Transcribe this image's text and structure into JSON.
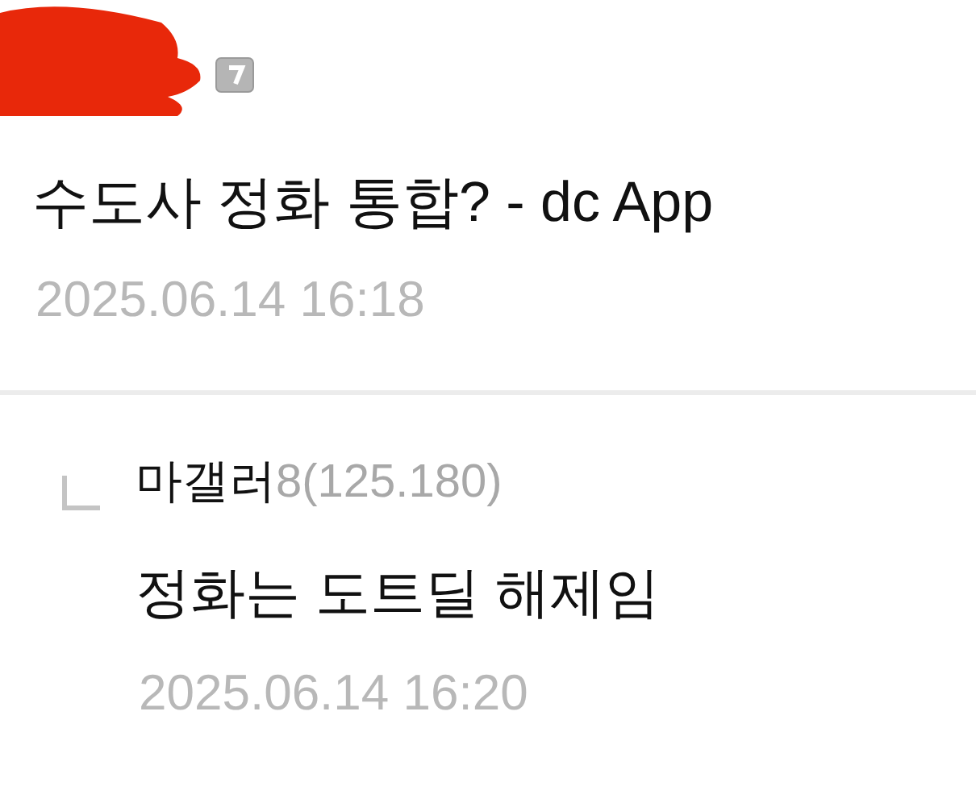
{
  "post": {
    "title": "수도사 정화 통합? - dc App",
    "date": "2025.06.14 16:18"
  },
  "reply": {
    "nickname": "마갤러",
    "ip": "8(125.180)",
    "text": "정화는 도트딜 해제임",
    "date": "2025.06.14 16:20"
  }
}
